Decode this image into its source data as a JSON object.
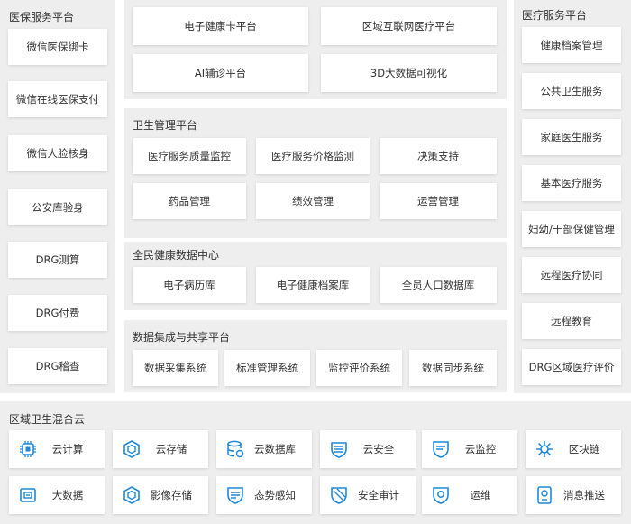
{
  "colors": {
    "accent": "#1e88d8",
    "panel": "#eeeeee",
    "box": "#ffffff",
    "text": "#333333"
  },
  "left": {
    "title": "医保服务平台",
    "items": [
      "微信医保绑卡",
      "微信在线医保支付",
      "微信人脸核身",
      "公安库验身",
      "DRG测算",
      "DRG付费",
      "DRG稽查"
    ]
  },
  "top": {
    "items": [
      "电子健康卡平台",
      "区域互联网医疗平台",
      "AI辅诊平台",
      "3D大数据可视化"
    ]
  },
  "health_mgmt": {
    "title": "卫生管理平台",
    "items": [
      "医疗服务质量监控",
      "医疗服务价格监测",
      "决策支持",
      "药品管理",
      "绩效管理",
      "运营管理"
    ]
  },
  "data_center": {
    "title": "全民健康数据中心",
    "items": [
      "电子病历库",
      "电子健康档案库",
      "全员人口数据库"
    ]
  },
  "integration": {
    "title": "数据集成与共享平台",
    "items": [
      "数据采集系统",
      "标准管理系统",
      "监控评价系统",
      "数据同步系统"
    ]
  },
  "right": {
    "title": "医疗服务平台",
    "items": [
      "健康档案管理",
      "公共卫生服务",
      "家庭医生服务",
      "基本医疗服务",
      "妇幼/干部保健管理",
      "远程医疗协同",
      "远程教育",
      "DRG区域医疗评价"
    ]
  },
  "cloud": {
    "title": "区域卫生混合云",
    "items": [
      {
        "label": "云计算",
        "icon": "chip-icon"
      },
      {
        "label": "云存储",
        "icon": "cloud-storage-icon"
      },
      {
        "label": "云数据库",
        "icon": "database-icon"
      },
      {
        "label": "云安全",
        "icon": "security-icon"
      },
      {
        "label": "云监控",
        "icon": "monitor-icon"
      },
      {
        "label": "区块链",
        "icon": "blockchain-icon"
      },
      {
        "label": "大数据",
        "icon": "bigdata-icon"
      },
      {
        "label": "影像存储",
        "icon": "image-storage-icon"
      },
      {
        "label": "态势感知",
        "icon": "awareness-icon"
      },
      {
        "label": "安全审计",
        "icon": "audit-shield-icon"
      },
      {
        "label": "运维",
        "icon": "ops-icon"
      },
      {
        "label": "消息推送",
        "icon": "message-push-icon"
      }
    ]
  }
}
